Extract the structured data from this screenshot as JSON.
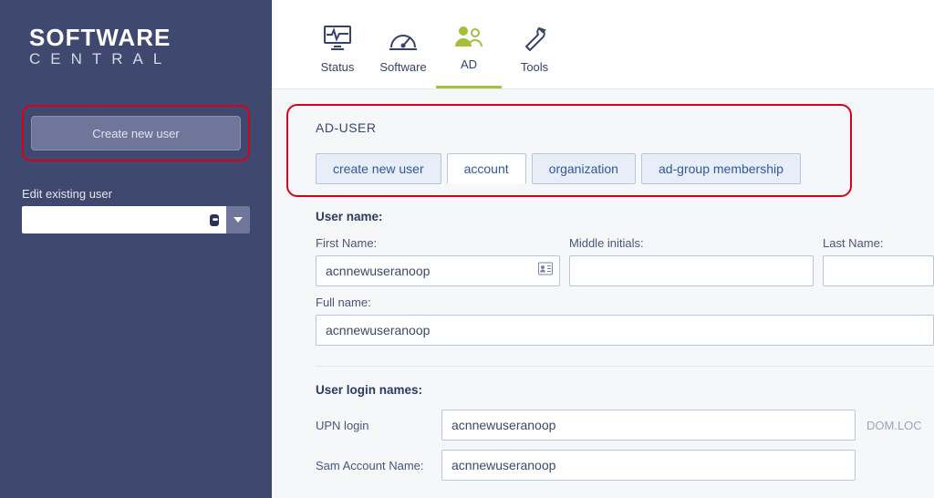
{
  "logo": {
    "line1": "SOFTWARE",
    "line2": "CENTRAL"
  },
  "sidebar": {
    "create_button_label": "Create new user",
    "edit_label": "Edit existing user",
    "edit_value": ""
  },
  "topnav": {
    "items": [
      {
        "label": "Status"
      },
      {
        "label": "Software"
      },
      {
        "label": "AD"
      },
      {
        "label": "Tools"
      }
    ],
    "active_index": 2
  },
  "section_title": "AD-USER",
  "tabs": {
    "items": [
      {
        "label": "create new user"
      },
      {
        "label": "account"
      },
      {
        "label": "organization"
      },
      {
        "label": "ad-group membership"
      }
    ],
    "active_index": 1
  },
  "form": {
    "user_name_heading": "User name:",
    "first_name_label": "First Name:",
    "first_name_value": "acnnewuseranoop",
    "middle_initials_label": "Middle initials:",
    "middle_initials_value": "",
    "last_name_label": "Last Name:",
    "last_name_value": "",
    "full_name_label": "Full name:",
    "full_name_value": "acnnewuseranoop",
    "login_heading": "User login names:",
    "upn_label": "UPN login",
    "upn_value": "acnnewuseranoop",
    "upn_suffix": "DOM.LOC",
    "sam_label": "Sam Account Name:",
    "sam_value": "acnnewuseranoop"
  }
}
